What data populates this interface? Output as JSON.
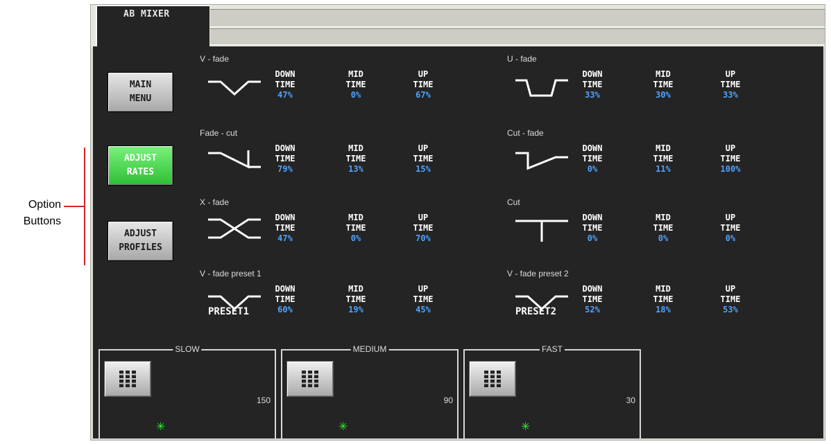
{
  "callout": {
    "label": "Option\nButtons"
  },
  "tab": {
    "label": "AB MIXER"
  },
  "side_buttons": [
    {
      "label": "MAIN\nMENU",
      "active": false
    },
    {
      "label": "ADJUST\nRATES",
      "active": true
    },
    {
      "label": "ADJUST\nPROFILES",
      "active": false
    }
  ],
  "metric_labels": {
    "down": "DOWN\nTIME",
    "mid": "MID\nTIME",
    "up": "UP\nTIME"
  },
  "transitions": [
    {
      "name": "V - fade",
      "icon": "v-fade-icon",
      "down": "47%",
      "mid": "0%",
      "up": "67%"
    },
    {
      "name": "U - fade",
      "icon": "u-fade-icon",
      "down": "33%",
      "mid": "30%",
      "up": "33%"
    },
    {
      "name": "Fade - cut",
      "icon": "fade-cut-icon",
      "down": "79%",
      "mid": "13%",
      "up": "15%"
    },
    {
      "name": "Cut - fade",
      "icon": "cut-fade-icon",
      "down": "0%",
      "mid": "11%",
      "up": "100%"
    },
    {
      "name": "X - fade",
      "icon": "x-fade-icon",
      "down": "47%",
      "mid": "0%",
      "up": "70%"
    },
    {
      "name": "Cut",
      "icon": "cut-icon",
      "down": "0%",
      "mid": "0%",
      "up": "0%"
    },
    {
      "name": "V - fade preset 1",
      "icon": "v-fade-icon",
      "preset": "PRESET1",
      "down": "60%",
      "mid": "19%",
      "up": "45%"
    },
    {
      "name": "V - fade preset 2",
      "icon": "v-fade-icon",
      "preset": "PRESET2",
      "down": "52%",
      "mid": "18%",
      "up": "53%"
    }
  ],
  "speeds": [
    {
      "label": "SLOW",
      "value": "150",
      "icon": "keypad-icon",
      "indicator": "star-icon"
    },
    {
      "label": "MEDIUM",
      "value": "90",
      "icon": "keypad-icon",
      "indicator": "star-icon"
    },
    {
      "label": "FAST",
      "value": "30",
      "icon": "keypad-icon",
      "indicator": "star-icon"
    }
  ],
  "colors": {
    "active_button": "#3fd345",
    "value_text": "#4fa3ff",
    "panel_bg": "#242424",
    "callout": "#d2232a"
  }
}
